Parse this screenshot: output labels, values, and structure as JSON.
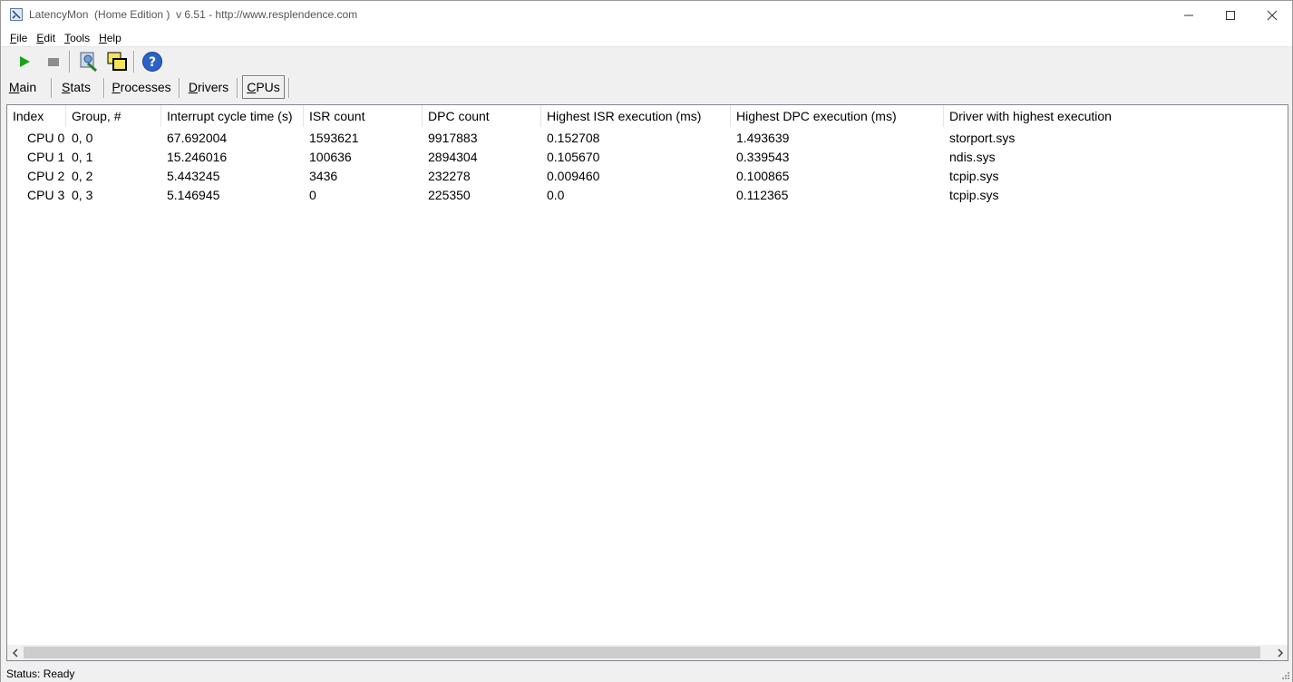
{
  "window": {
    "title": "LatencyMon  (Home Edition )  v 6.51 - http://www.resplendence.com",
    "icon": "app-icon"
  },
  "menu": [
    {
      "label": "File",
      "accel": "F",
      "rest": "ile"
    },
    {
      "label": "Edit",
      "accel": "E",
      "rest": "dit"
    },
    {
      "label": "Tools",
      "accel": "T",
      "rest": "ools"
    },
    {
      "label": "Help",
      "accel": "H",
      "rest": "elp"
    }
  ],
  "toolbar": {
    "icons": [
      "play-icon",
      "stop-icon",
      "report-icon",
      "windows-icon",
      "help-icon"
    ],
    "colors": {
      "play": "#1aa31a",
      "stop": "#8c8c8c",
      "help": "#2a62c9"
    }
  },
  "tabs": [
    {
      "label": "Main",
      "accel": "M",
      "rest": "ain",
      "active": false
    },
    {
      "label": "Stats",
      "accel": "S",
      "rest": "tats",
      "active": false
    },
    {
      "label": "Processes",
      "accel": "P",
      "rest": "rocesses",
      "active": false
    },
    {
      "label": "Drivers",
      "accel": "D",
      "rest": "rivers",
      "active": false
    },
    {
      "label": "CPUs",
      "accel": "C",
      "rest": "PUs",
      "active": true
    }
  ],
  "table": {
    "columns": [
      "Index",
      "Group, #",
      "Interrupt cycle time (s)",
      "ISR count",
      "DPC count",
      "Highest ISR execution (ms)",
      "Highest DPC execution (ms)",
      "Driver with highest execution"
    ],
    "rows": [
      [
        "CPU 0",
        "0, 0",
        "67.692004",
        "1593621",
        "9917883",
        "0.152708",
        "1.493639",
        "storport.sys"
      ],
      [
        "CPU 1",
        "0, 1",
        "15.246016",
        "100636",
        "2894304",
        "0.105670",
        "0.339543",
        "ndis.sys"
      ],
      [
        "CPU 2",
        "0, 2",
        "5.443245",
        "3436",
        "232278",
        "0.009460",
        "0.100865",
        "tcpip.sys"
      ],
      [
        "CPU 3",
        "0, 3",
        "5.146945",
        "0",
        "225350",
        "0.0",
        "0.112365",
        "tcpip.sys"
      ]
    ]
  },
  "status": {
    "text": "Status: Ready"
  }
}
